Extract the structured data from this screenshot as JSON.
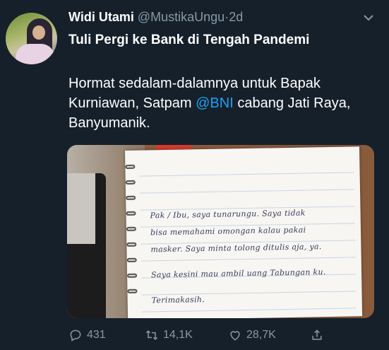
{
  "tweet": {
    "display_name": "Widi Utami",
    "handle": "@MustikaUngu",
    "separator": "·",
    "time": "2d",
    "title": "Tuli Pergi ke Bank di Tengah Pandemi",
    "body_part1": "Hormat sedalam-dalamnya untuk Bapak Kurniawan, Satpam ",
    "mention": "@BNI",
    "body_part2": " cabang Jati Raya, Banyumanik.",
    "note_lines": [
      "Pak / Ibu, saya tunarungu. Saya tidak",
      "bisa memahami omongan kalau pakai",
      "masker. Saya minta tolong ditulis aja, ya.",
      "Saya kesini mau ambil uang Tabungan ku.",
      "Terimakasih."
    ]
  },
  "actions": {
    "reply_count": "431",
    "retweet_count": "14,1K",
    "like_count": "28,7K"
  },
  "icons": {
    "more": "chevron-down-icon",
    "reply": "reply-icon",
    "retweet": "retweet-icon",
    "like": "heart-icon",
    "share": "share-icon"
  },
  "colors": {
    "background": "#15202b",
    "secondary_text": "#8899a6",
    "link": "#1da1f2"
  }
}
